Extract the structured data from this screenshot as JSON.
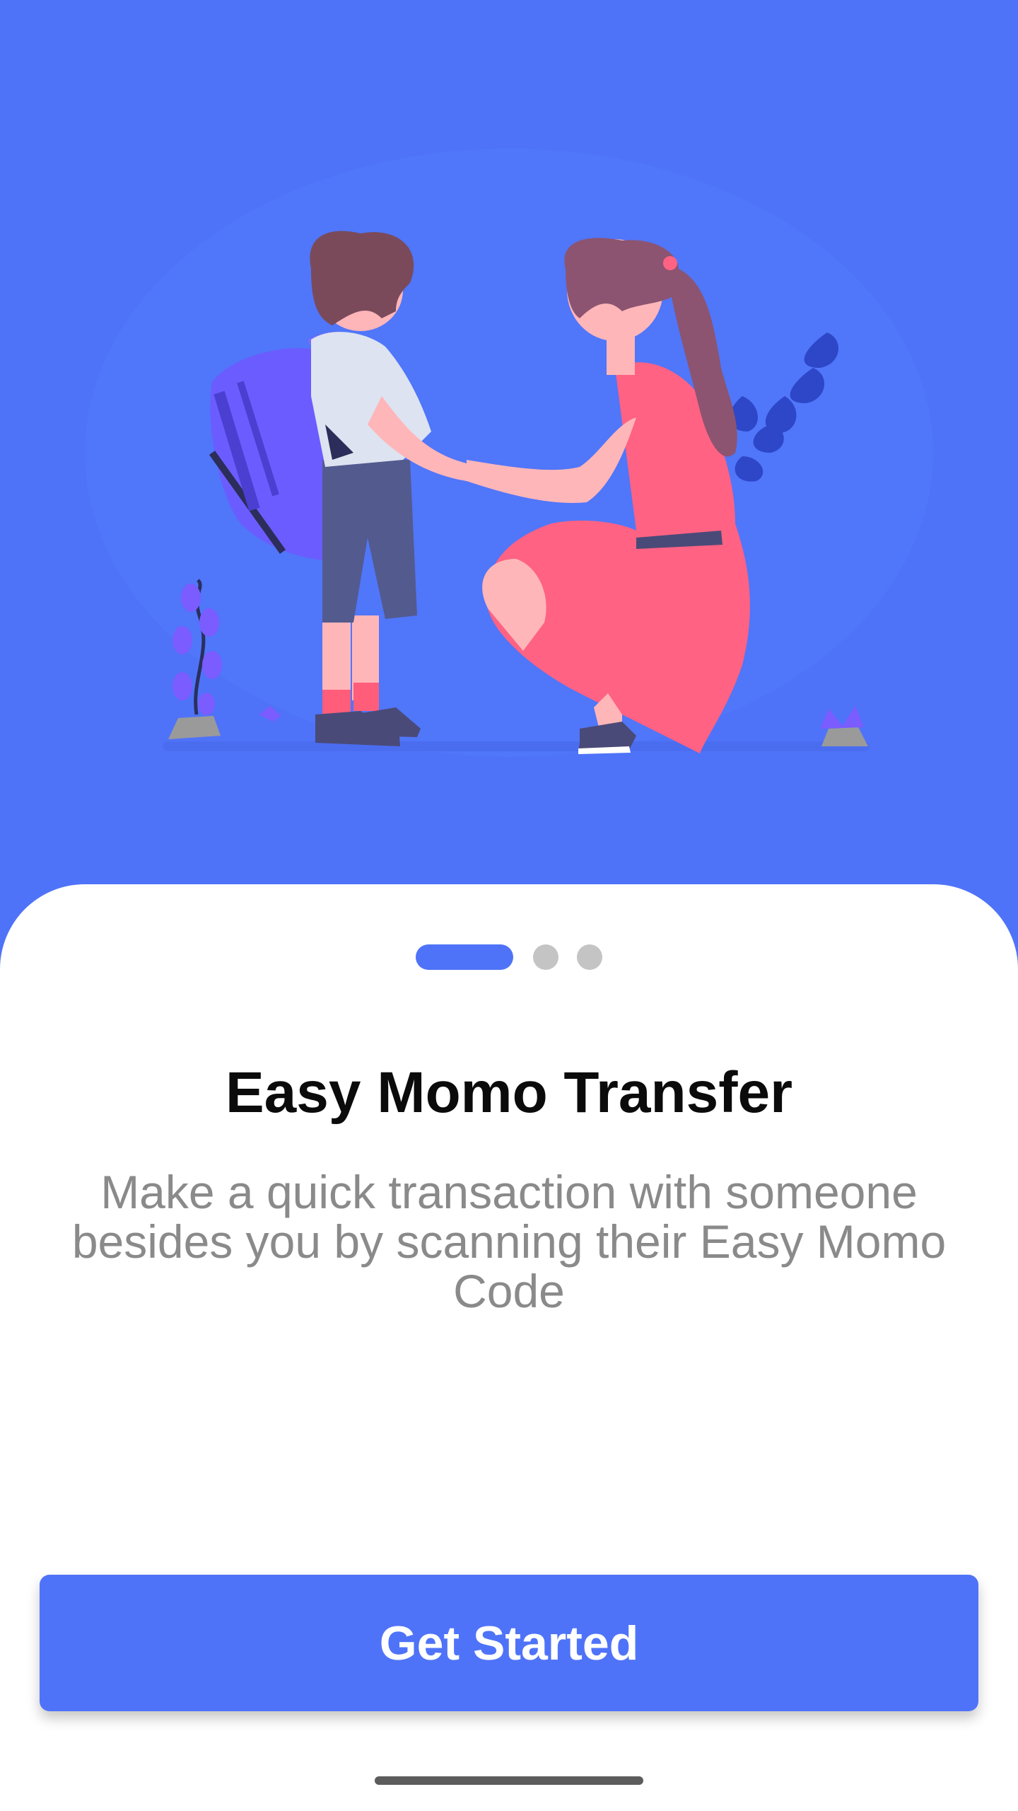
{
  "colors": {
    "accent": "#4f73f8",
    "dot_inactive": "#c4c4c4",
    "title": "#0b0b0b",
    "description": "#8a8a8a"
  },
  "onboarding": {
    "illustration": "mother-and-child-illustration",
    "page_indicator": {
      "total": 3,
      "active": 1
    },
    "title": "Easy Momo Transfer",
    "description": "Make a quick transaction with someone besides you by scanning their Easy Momo Code",
    "cta_label": "Get Started"
  }
}
